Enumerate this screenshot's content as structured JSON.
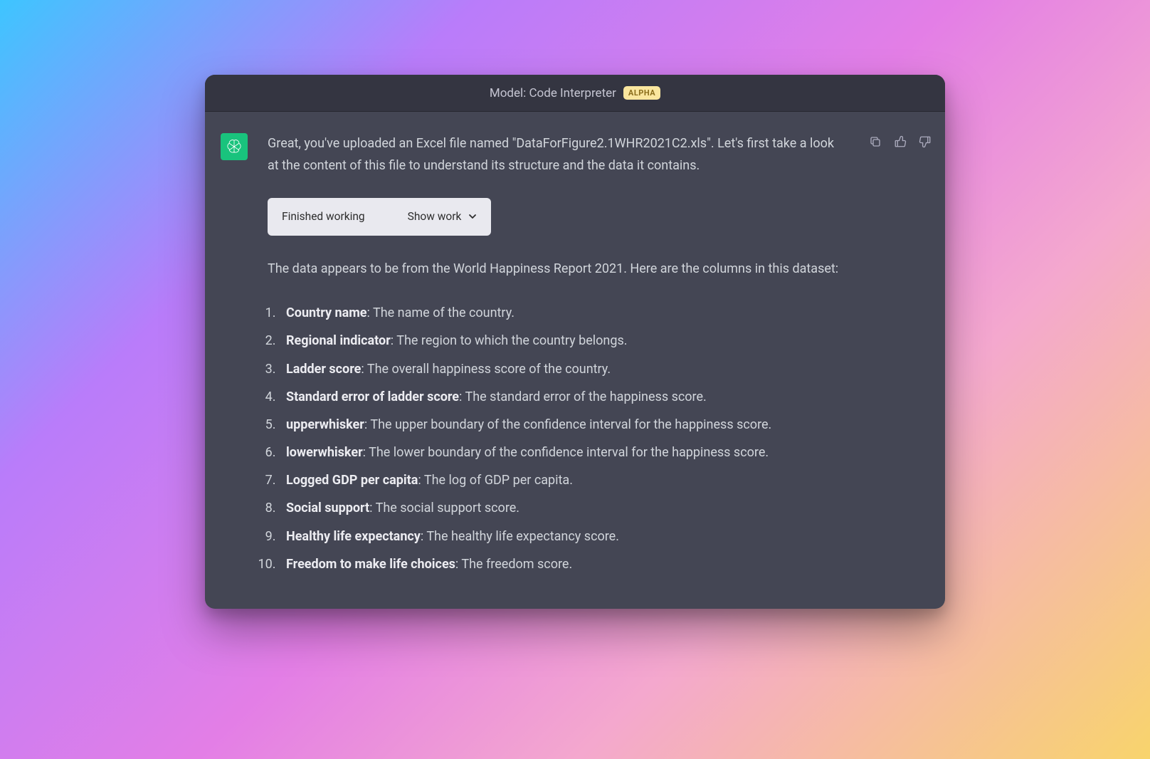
{
  "header": {
    "model_label": "Model: Code Interpreter",
    "badge": "ALPHA"
  },
  "actions": {
    "copy_name": "copy-icon",
    "thumbs_up_name": "thumbs-up-icon",
    "thumbs_down_name": "thumbs-down-icon"
  },
  "message": {
    "intro": "Great, you've uploaded an Excel file named \"DataForFigure2.1WHR2021C2.xls\". Let's first take a look at the content of this file to understand its structure and the data it contains.",
    "work_box": {
      "status": "Finished working",
      "toggle": "Show work"
    },
    "columns_intro": "The data appears to be from the World Happiness Report 2021. Here are the columns in this dataset:",
    "columns": [
      {
        "term": "Country name",
        "desc": ": The name of the country."
      },
      {
        "term": "Regional indicator",
        "desc": ": The region to which the country belongs."
      },
      {
        "term": "Ladder score",
        "desc": ": The overall happiness score of the country."
      },
      {
        "term": "Standard error of ladder score",
        "desc": ": The standard error of the happiness score."
      },
      {
        "term": "upperwhisker",
        "desc": ": The upper boundary of the confidence interval for the happiness score."
      },
      {
        "term": "lowerwhisker",
        "desc": ": The lower boundary of the confidence interval for the happiness score."
      },
      {
        "term": "Logged GDP per capita",
        "desc": ": The log of GDP per capita."
      },
      {
        "term": "Social support",
        "desc": ": The social support score."
      },
      {
        "term": "Healthy life expectancy",
        "desc": ": The healthy life expectancy score."
      },
      {
        "term": "Freedom to make life choices",
        "desc": ": The freedom score."
      }
    ]
  }
}
